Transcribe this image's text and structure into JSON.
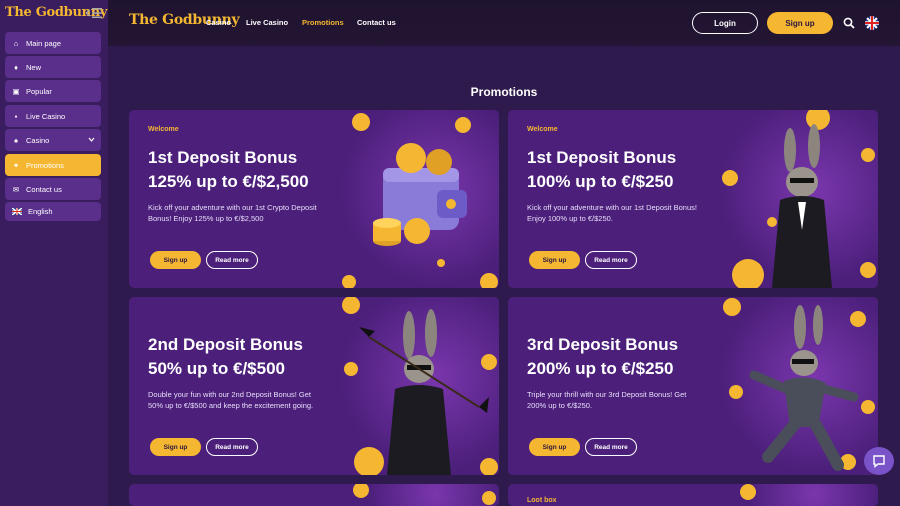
{
  "brand": {
    "logo_text": "The Godbunny",
    "accent": "#f5b731",
    "primary": "#5a2f8c"
  },
  "sidebar": {
    "items": [
      {
        "label": "Main page",
        "icon": "home-icon"
      },
      {
        "label": "New",
        "icon": "fire-icon"
      },
      {
        "label": "Popular",
        "icon": "popular-icon"
      },
      {
        "label": "Live Casino",
        "icon": "live-icon"
      },
      {
        "label": "Casino",
        "icon": "casino-icon"
      },
      {
        "label": "Promotions",
        "icon": "promo-icon"
      },
      {
        "label": "Contact us",
        "icon": "mail-icon"
      },
      {
        "label": "English",
        "icon": "uk-flag-icon"
      }
    ]
  },
  "header": {
    "nav": [
      "Casino",
      "Live Casino",
      "Promotions",
      "Contact us"
    ],
    "login": "Login",
    "signup": "Sign up"
  },
  "page": {
    "title": "Promotions"
  },
  "cards": [
    {
      "tag": "Welcome",
      "title1": "1st Deposit Bonus",
      "title2": "125% up to €/$2,500",
      "desc": "Kick off your adventure with our 1st Crypto Deposit Bonus! Enjoy 125% up to €/$2,500",
      "signup": "Sign up",
      "readmore": "Read more"
    },
    {
      "tag": "Welcome",
      "title1": "1st Deposit Bonus",
      "title2": "100% up to €/$250",
      "desc": "Kick off your adventure with our 1st Deposit Bonus! Enjoy 100% up to €/$250.",
      "signup": "Sign up",
      "readmore": "Read more"
    },
    {
      "tag": "",
      "title1": "2nd Deposit Bonus",
      "title2": "50% up to €/$500",
      "desc": "Double your fun with our 2nd Deposit Bonus! Get 50% up to €/$500 and keep the excitement going.",
      "signup": "Sign up",
      "readmore": "Read more"
    },
    {
      "tag": "",
      "title1": "3rd Deposit Bonus",
      "title2": "200% up to €/$250",
      "desc": "Triple your thrill with our 3rd Deposit Bonus! Get 200% up to €/$250.",
      "signup": "Sign up",
      "readmore": "Read more"
    },
    {
      "tag": "Loot box"
    }
  ]
}
